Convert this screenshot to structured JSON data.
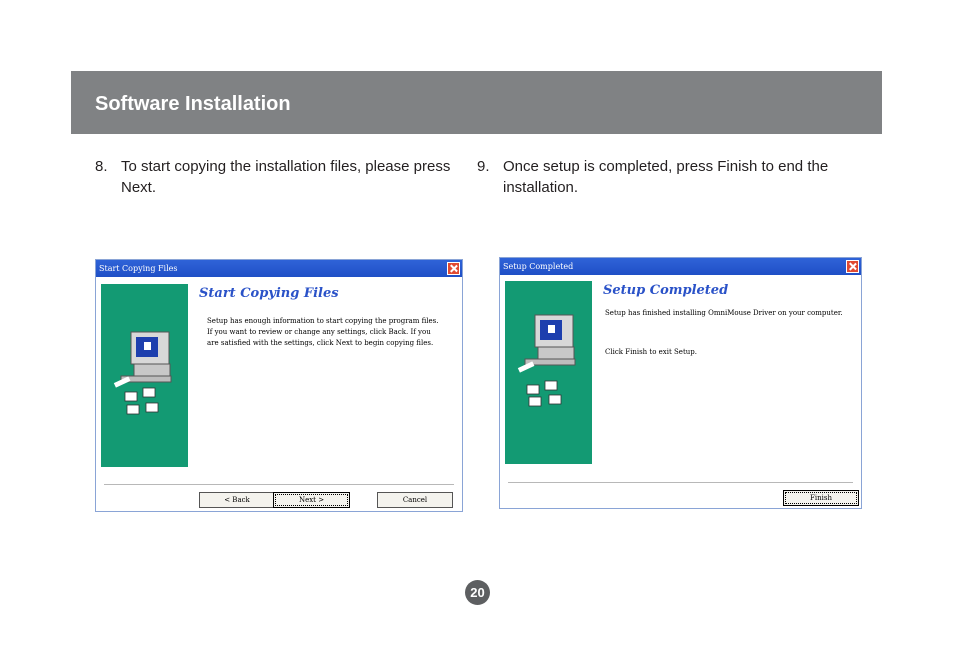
{
  "header": {
    "title": "Software Installation"
  },
  "steps": [
    {
      "number": "8.",
      "text": "To start copying the installation files, please press Next."
    },
    {
      "number": "9.",
      "text": "Once setup is completed, press Finish to end the installation."
    }
  ],
  "dialog_copy": {
    "title": "Start Copying Files",
    "heading": "Start Copying Files",
    "body": "Setup has enough information to start copying the program files.  If you want to review or change any settings, click Back.  If you are satisfied with the settings, click Next to begin copying files.",
    "back_label": "< Back",
    "next_label": "Next >",
    "cancel_label": "Cancel"
  },
  "dialog_done": {
    "title": "Setup Completed",
    "heading": "Setup Completed",
    "line1": "Setup has finished installing OmniMouse Driver on your computer.",
    "line2": "Click Finish to exit Setup.",
    "finish_label": "Finish"
  },
  "page_number": "20",
  "colors": {
    "header_bg": "#808284",
    "panel_green": "#139a73",
    "title_bar": "#2f63d8",
    "heading_blue": "#2a52c8"
  }
}
